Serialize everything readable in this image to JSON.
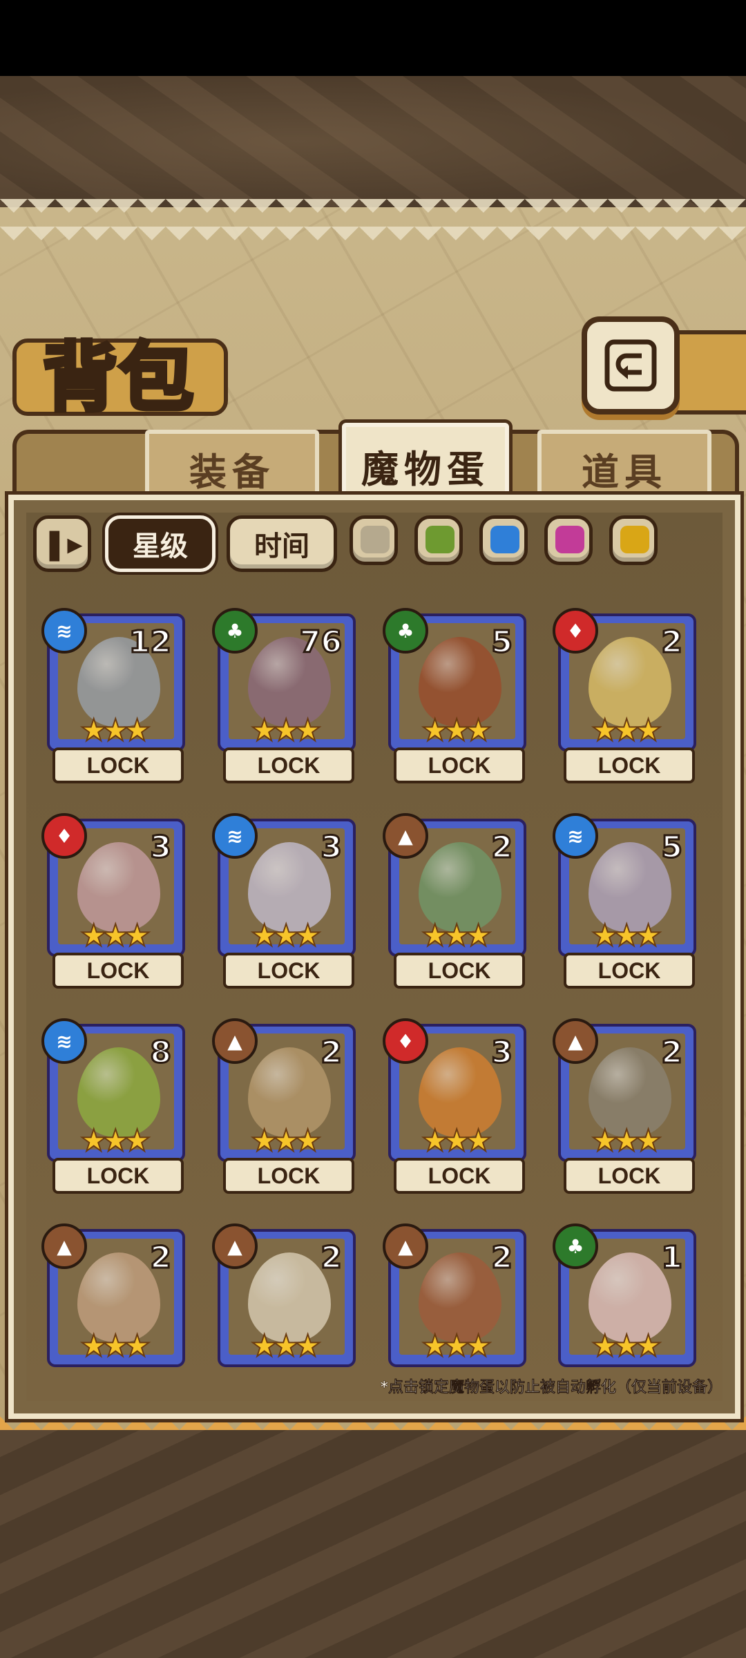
{
  "title": "背包",
  "tabs": [
    {
      "label": "装备",
      "active": false
    },
    {
      "label": "魔物蛋",
      "active": true
    },
    {
      "label": "道具",
      "active": false
    }
  ],
  "filters": {
    "sort_icon": "sort-toggle-icon",
    "star_label": "星级",
    "time_label": "时间",
    "swatches": [
      "#b5a98e",
      "#6e9a30",
      "#2f7fd8",
      "#c23b98",
      "#d9a616"
    ]
  },
  "eggs": [
    {
      "element": "water",
      "count": "12",
      "stars": "★★★",
      "lock": "LOCK",
      "color": "#9aa3b0"
    },
    {
      "element": "leaf",
      "count": "76",
      "stars": "★★★",
      "lock": "LOCK",
      "color": "#8d6a80"
    },
    {
      "element": "leaf",
      "count": "5",
      "stars": "★★★",
      "lock": "LOCK",
      "color": "#9b4a2a"
    },
    {
      "element": "fire",
      "count": "2",
      "stars": "★★★",
      "lock": "LOCK",
      "color": "#e2c56a"
    },
    {
      "element": "fire",
      "count": "3",
      "stars": "★★★",
      "lock": "LOCK",
      "color": "#c9a0a6"
    },
    {
      "element": "water",
      "count": "3",
      "stars": "★★★",
      "lock": "LOCK",
      "color": "#c8c2d8"
    },
    {
      "element": "earth",
      "count": "2",
      "stars": "★★★",
      "lock": "LOCK",
      "color": "#6f9a6a"
    },
    {
      "element": "water",
      "count": "5",
      "stars": "★★★",
      "lock": "LOCK",
      "color": "#b4a9c8"
    },
    {
      "element": "water",
      "count": "8",
      "stars": "★★★",
      "lock": "LOCK",
      "color": "#8fb23f"
    },
    {
      "element": "earth",
      "count": "2",
      "stars": "★★★",
      "lock": "LOCK",
      "color": "#b99b6e"
    },
    {
      "element": "fire",
      "count": "3",
      "stars": "★★★",
      "lock": "LOCK",
      "color": "#d9812e"
    },
    {
      "element": "earth",
      "count": "2",
      "stars": "★★★",
      "lock": "LOCK",
      "color": "#8c8474"
    },
    {
      "element": "earth",
      "count": "2",
      "stars": "★★★",
      "lock": "",
      "color": "#c7a483"
    },
    {
      "element": "earth",
      "count": "2",
      "stars": "★★★",
      "lock": "",
      "color": "#e0d4bb"
    },
    {
      "element": "earth",
      "count": "2",
      "stars": "★★★",
      "lock": "",
      "color": "#a15a3a"
    },
    {
      "element": "leaf",
      "count": "1",
      "stars": "★★★",
      "lock": "",
      "color": "#e7c6c6"
    }
  ],
  "footnote": "*点击锁定魔物蛋以防止被自动孵化（仅当前设备）"
}
